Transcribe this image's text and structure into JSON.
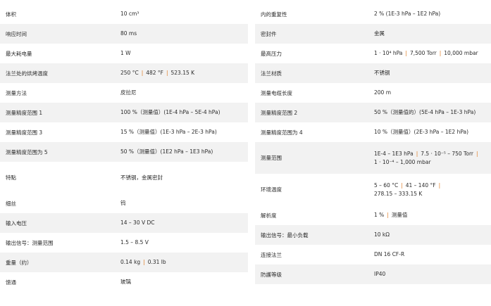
{
  "separator": "|",
  "accent_color": "#e07a1f",
  "left": [
    {
      "label": "体积",
      "value": [
        "10 cm³"
      ]
    },
    {
      "label": "响应时间",
      "value": [
        "80 ms"
      ]
    },
    {
      "label": "最大耗电量",
      "value": [
        "1 W"
      ]
    },
    {
      "label": "法兰处的烘烤温度",
      "value": [
        "250 °C",
        "482 °F",
        "523.15 K"
      ]
    },
    {
      "label": "测量方法",
      "value": [
        "皮拉尼"
      ]
    },
    {
      "label": "测量精度范围 1",
      "value": [
        "100 %（测量值）(1E-4 hPa – 5E-4 hPa)"
      ]
    },
    {
      "label": "测量精度范围 3",
      "value": [
        "15 %（测量值）(1E-3 hPa – 2E-3 hPa)"
      ]
    },
    {
      "label": "测量精度范围为 5",
      "value": [
        "50 %（测量值）(1E2 hPa – 1E3 hPa)"
      ]
    },
    {
      "label": "特點",
      "value": [
        "不锈钢，金属密封"
      ]
    },
    {
      "label": "细丝",
      "value": [
        "钨"
      ]
    },
    {
      "label": "输入电压",
      "value": [
        "14 – 30 V DC"
      ]
    },
    {
      "label": "输出信号：测量范围",
      "value": [
        "1.5 – 8.5 V"
      ]
    },
    {
      "label": "重量（约）",
      "value": [
        "0.14 kg",
        "0.31 lb"
      ]
    },
    {
      "label": "馈通",
      "value": [
        "玻璃"
      ]
    }
  ],
  "right": [
    {
      "label": "内的重复性",
      "value": [
        "2 % (1E-3 hPa – 1E2 hPa)"
      ]
    },
    {
      "label": "密封件",
      "value": [
        "金属"
      ]
    },
    {
      "label": "最高压力",
      "value": [
        "1 · 10⁴ hPa",
        "7,500 Torr",
        "10,000 mbar"
      ]
    },
    {
      "label": "法兰材质",
      "value": [
        "不锈钢"
      ]
    },
    {
      "label": "测量电缆长度",
      "value": [
        "200 m"
      ]
    },
    {
      "label": "测量精度范围 2",
      "value": [
        "50 %（测量值的）(5E-4 hPa – 1E-3 hPa)"
      ]
    },
    {
      "label": "测量精度范围为 4",
      "value": [
        "10 %（测量值）(2E-3 hPa – 1E2 hPa)"
      ]
    },
    {
      "label": "测量范围",
      "value": [
        "1E-4 – 1E3 hPa",
        "7.5 · 10⁻⁵ – 750 Torr",
        "1 · 10⁻⁴ – 1,000 mbar"
      ]
    },
    {
      "label": "环境温度",
      "value": [
        "5 – 60 °C",
        "41 – 140 °F",
        "278.15 – 333.15 K"
      ]
    },
    {
      "label": "解析度",
      "value": [
        "1 %",
        "测量值"
      ]
    },
    {
      "label": "输出信号：最小负载",
      "value": [
        "10 kΩ"
      ]
    },
    {
      "label": "连接法兰",
      "value": [
        "DN 16 CF-R"
      ]
    },
    {
      "label": "防護等级",
      "value": [
        "IP40"
      ]
    }
  ]
}
